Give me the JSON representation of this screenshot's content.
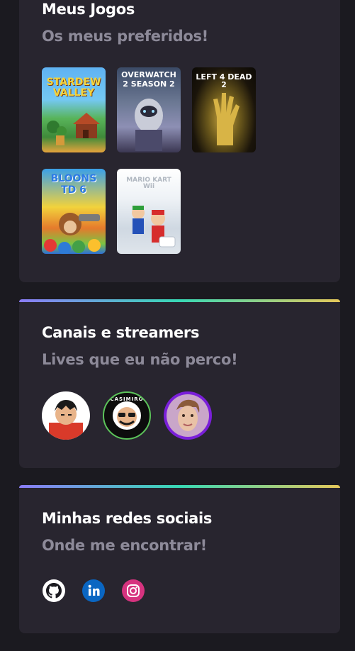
{
  "games_section": {
    "title": "Meus Jogos",
    "subtitle": "Os meus preferidos!",
    "games": [
      {
        "label": "STARDEW VALLEY"
      },
      {
        "label": "OVERWATCH 2 SEASON 2"
      },
      {
        "label": "LEFT 4 DEAD 2"
      },
      {
        "label": "BLOONS TD 6"
      },
      {
        "label": "MARIO KART Wii"
      }
    ]
  },
  "streamers_section": {
    "title": "Canais e streamers",
    "subtitle": "Lives que eu não perco!",
    "avatar_badge": "CASIMIRO"
  },
  "socials_section": {
    "title": "Minhas redes sociais",
    "subtitle": "Onde me encontrar!",
    "links": [
      {
        "icon": "github-icon",
        "color": "#ffffff"
      },
      {
        "icon": "linkedin-icon",
        "color": "#0a66c2"
      },
      {
        "icon": "instagram-icon",
        "color": "#d6337f"
      }
    ]
  },
  "theme": {
    "background": "#1b1a20",
    "card": "#28252f",
    "subtitle_color": "#8d8a99",
    "gradient": [
      "#8b7cf7",
      "#38d9b5",
      "#e6c85a"
    ]
  }
}
